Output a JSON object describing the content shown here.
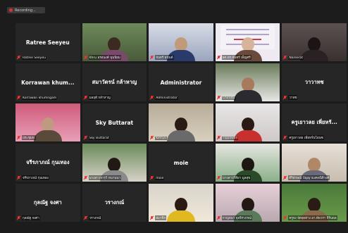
{
  "recording": {
    "label": "Recording..."
  },
  "colors": {
    "accent": "#c7d84a",
    "mic_muted": "#e33333",
    "tile_bg": "#262626"
  },
  "tiles": [
    {
      "type": "name",
      "display": "Ratree Seeyeu",
      "label": "Ratree Seeyeu"
    },
    {
      "type": "video",
      "label": "Khru อรอนงค์ นุนนิยม",
      "scene": "classroom",
      "highlight": true
    },
    {
      "type": "video",
      "label": "จันทร์ ธนันต์",
      "scene": "man-blue"
    },
    {
      "type": "video",
      "label": "ผศ.ดร.จันทร์ เพ็ญศรี",
      "scene": "poster"
    },
    {
      "type": "video",
      "label": "Nareerat",
      "scene": "woman-dark"
    },
    {
      "type": "name",
      "display": "Korrawan khum...",
      "label": "Korrawan khumngam"
    },
    {
      "type": "name",
      "display": "สมาวัตรน์ กล้าหาญ",
      "label": "มลฤดี กล้าหาญ"
    },
    {
      "type": "name",
      "display": "Administrator",
      "label": "Administrator"
    },
    {
      "type": "video",
      "label": "Chiratty",
      "scene": "man-window"
    },
    {
      "type": "name",
      "display": "วาวาทช",
      "label": "วาทช"
    },
    {
      "type": "video",
      "label": "ประชุมพ.",
      "scene": "stage"
    },
    {
      "type": "name",
      "display": "Sky Buttarat",
      "label": "Sky Buttarat"
    },
    {
      "type": "video",
      "label": "Ketryo",
      "scene": "woman-room"
    },
    {
      "type": "video",
      "label": "Tippawan",
      "scene": "woman-glasses"
    },
    {
      "type": "name",
      "display": "ครูเยาวลย เพี่ยหรั...",
      "label": "ครูเยาวลย เพี่ยหรั่นโอนซ"
    },
    {
      "type": "name",
      "display": "จรีรภาภณ์ กุนเทอง",
      "label": "จรีรภาภณ์ กุนเทอง"
    },
    {
      "type": "video",
      "label": "นางสาวจารุวี หนานนา",
      "scene": "woman-curtain"
    },
    {
      "type": "name",
      "display": "moie",
      "label": "moie"
    },
    {
      "type": "video",
      "label": "นางสาวกิติยา มูลสุข",
      "scene": "woman-green"
    },
    {
      "type": "video",
      "label": "ศิริลักษณ์ ปัญญามงคลนิติวงศ์",
      "scene": "man-office"
    },
    {
      "type": "name",
      "display": "กุลณัฐ จงศา",
      "label": "กุลณัฐ จงศา"
    },
    {
      "type": "name",
      "display": "วรางกณ์",
      "label": "วรางกณ์"
    },
    {
      "type": "video",
      "label": "สมาชิก",
      "scene": "woman-yellow"
    },
    {
      "type": "video",
      "label": "กาญจนา จุลจิราภรณ์",
      "scene": "woman-pink"
    },
    {
      "type": "video",
      "label": "ครูจง จัดจุดต่าง อา.ทัพวรา จิรินพล",
      "scene": "woman-plants"
    }
  ]
}
